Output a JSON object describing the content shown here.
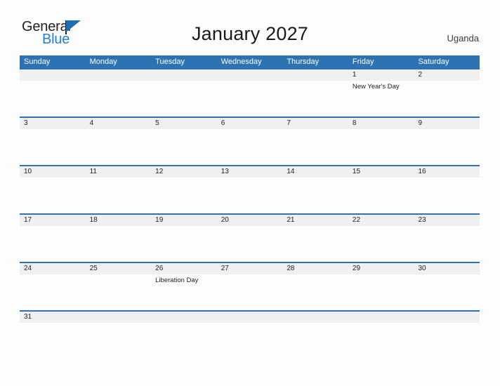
{
  "logo": {
    "word_top": "General",
    "word_bottom": "Blue",
    "triangle_color": "#1b6fb5",
    "blue_text_color": "#1f7fd0"
  },
  "header": {
    "title": "January 2027",
    "region": "Uganda"
  },
  "colors": {
    "header_blue": "#2d73b4",
    "row_band": "#f0f0f0",
    "page_bg": "#fdfdfd",
    "text_dark": "#1d1d1d"
  },
  "calendar": {
    "weekday_headers": [
      "Sunday",
      "Monday",
      "Tuesday",
      "Wednesday",
      "Thursday",
      "Friday",
      "Saturday"
    ],
    "weeks": [
      {
        "days": [
          {
            "number": "",
            "event": ""
          },
          {
            "number": "",
            "event": ""
          },
          {
            "number": "",
            "event": ""
          },
          {
            "number": "",
            "event": ""
          },
          {
            "number": "",
            "event": ""
          },
          {
            "number": "1",
            "event": "New Year's Day"
          },
          {
            "number": "2",
            "event": ""
          }
        ]
      },
      {
        "days": [
          {
            "number": "3",
            "event": ""
          },
          {
            "number": "4",
            "event": ""
          },
          {
            "number": "5",
            "event": ""
          },
          {
            "number": "6",
            "event": ""
          },
          {
            "number": "7",
            "event": ""
          },
          {
            "number": "8",
            "event": ""
          },
          {
            "number": "9",
            "event": ""
          }
        ]
      },
      {
        "days": [
          {
            "number": "10",
            "event": ""
          },
          {
            "number": "11",
            "event": ""
          },
          {
            "number": "12",
            "event": ""
          },
          {
            "number": "13",
            "event": ""
          },
          {
            "number": "14",
            "event": ""
          },
          {
            "number": "15",
            "event": ""
          },
          {
            "number": "16",
            "event": ""
          }
        ]
      },
      {
        "days": [
          {
            "number": "17",
            "event": ""
          },
          {
            "number": "18",
            "event": ""
          },
          {
            "number": "19",
            "event": ""
          },
          {
            "number": "20",
            "event": ""
          },
          {
            "number": "21",
            "event": ""
          },
          {
            "number": "22",
            "event": ""
          },
          {
            "number": "23",
            "event": ""
          }
        ]
      },
      {
        "days": [
          {
            "number": "24",
            "event": ""
          },
          {
            "number": "25",
            "event": ""
          },
          {
            "number": "26",
            "event": "Liberation Day"
          },
          {
            "number": "27",
            "event": ""
          },
          {
            "number": "28",
            "event": ""
          },
          {
            "number": "29",
            "event": ""
          },
          {
            "number": "30",
            "event": ""
          }
        ]
      },
      {
        "days": [
          {
            "number": "31",
            "event": ""
          },
          {
            "number": "",
            "event": ""
          },
          {
            "number": "",
            "event": ""
          },
          {
            "number": "",
            "event": ""
          },
          {
            "number": "",
            "event": ""
          },
          {
            "number": "",
            "event": ""
          },
          {
            "number": "",
            "event": ""
          }
        ]
      }
    ]
  }
}
